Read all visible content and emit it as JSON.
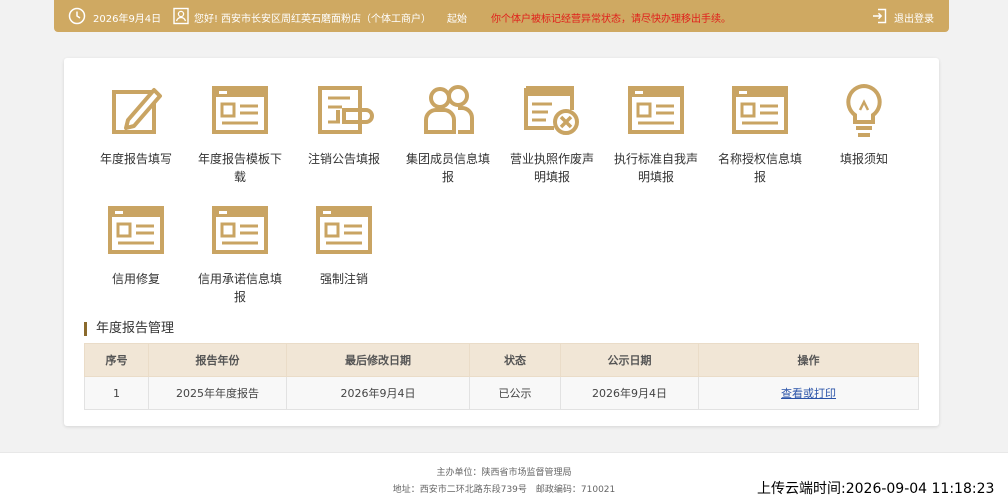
{
  "header": {
    "date": "2026年9月4日",
    "greeting": "您好!",
    "business_name": "西安市长安区周红英石磨面粉店（个体工商户）",
    "origin": "起始",
    "warning": "你个体户被标记经营异常状态，请尽快办理移出手续。",
    "logout": "退出登录"
  },
  "tiles": [
    {
      "label": "年度报告填写",
      "icon": "edit-icon"
    },
    {
      "label": "年度报告模板下载",
      "icon": "template-icon"
    },
    {
      "label": "注销公告填报",
      "icon": "cancel-notice-icon"
    },
    {
      "label": "集团成员信息填报",
      "icon": "group-members-icon"
    },
    {
      "label": "营业执照作废声明填报",
      "icon": "license-void-icon"
    },
    {
      "label": "执行标准自我声明填报",
      "icon": "standard-icon"
    },
    {
      "label": "名称授权信息填报",
      "icon": "name-auth-icon"
    },
    {
      "label": "填报须知",
      "icon": "lightbulb-icon"
    },
    {
      "label": "信用修复",
      "icon": "credit-repair-icon"
    },
    {
      "label": "信用承诺信息填报",
      "icon": "credit-promise-icon"
    },
    {
      "label": "强制注销",
      "icon": "forced-cancel-icon"
    }
  ],
  "section": {
    "title": "年度报告管理"
  },
  "table": {
    "headers": [
      "序号",
      "报告年份",
      "最后修改日期",
      "状态",
      "公示日期",
      "操作"
    ],
    "rows": [
      [
        "1",
        "2025年年度报告",
        "2026年9月4日",
        "已公示",
        "2026年9月4日",
        "查看或打印"
      ]
    ]
  },
  "footer": {
    "line1": "主办单位：陕西省市场监督管理局",
    "line2": "地址：西安市二环北路东段739号　邮政编码：710021"
  },
  "upload_stamp": "上传云端时间:2026-09-04 11:18:23",
  "colors": {
    "accent": "#cfa962",
    "icon": "#c9a463",
    "warning": "#e0201b",
    "link": "#2a53a8"
  }
}
